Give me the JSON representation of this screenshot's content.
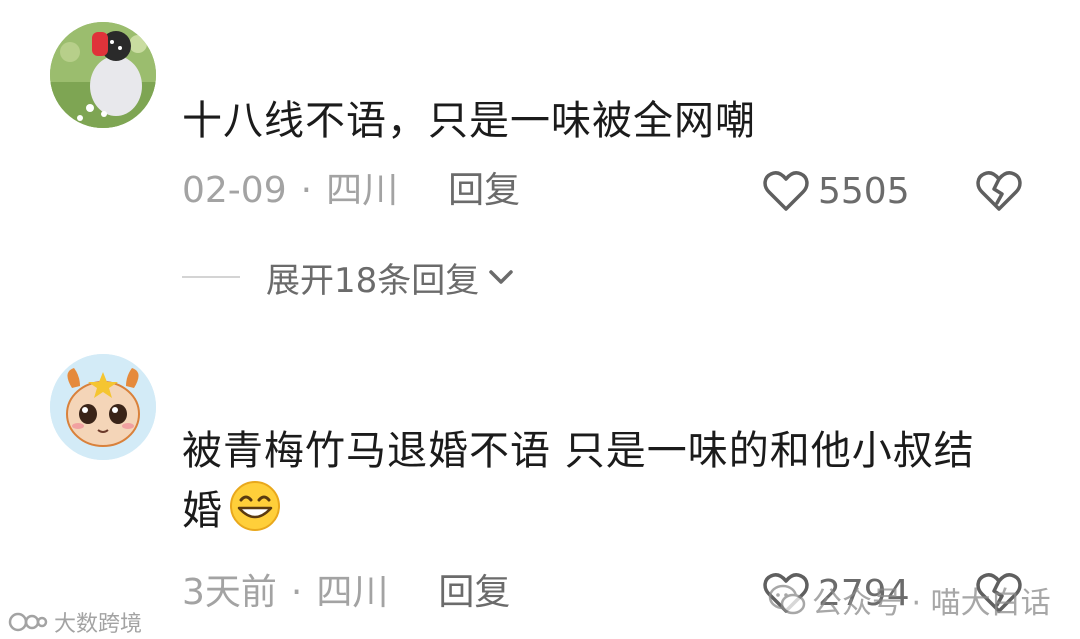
{
  "comments": [
    {
      "text": "十八线不语，只是一味被全网嘲",
      "date": "02-09",
      "separator": "·",
      "location": "四川",
      "reply_label": "回复",
      "likes": "5505",
      "expand_label": "展开18条回复"
    },
    {
      "text": "被青梅竹马退婚不语 只是一味的和他小叔结婚",
      "date": "3天前",
      "separator": "·",
      "location": "四川",
      "reply_label": "回复",
      "likes": "2794"
    }
  ],
  "watermarks": {
    "left": "大数跨境",
    "right": "公众号 · 喵大白话"
  },
  "icons": {
    "like": "heart-outline-icon",
    "dislike": "broken-heart-icon",
    "expand": "chevron-down-icon",
    "emoji": "grinning-face-emoji"
  },
  "colors": {
    "primary_text": "#1b1b1b",
    "meta_text": "#a3a3a3",
    "action_text": "#6b6b6b"
  }
}
